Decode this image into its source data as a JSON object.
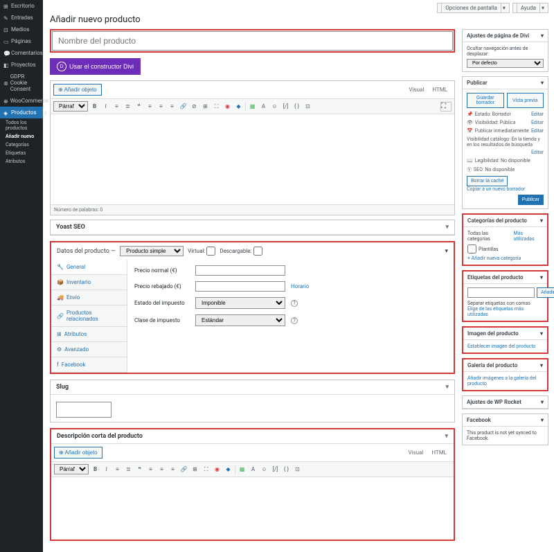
{
  "topbar": {
    "screen_options": "Opciones de pantalla",
    "help": "Ayuda"
  },
  "page_title": "Añadir nuevo producto",
  "title_placeholder": "Nombre del producto",
  "divi_btn": "Usar el constructor Divi",
  "sidebar": {
    "items": [
      {
        "label": "Escritorio"
      },
      {
        "label": "Entradas"
      },
      {
        "label": "Medios"
      },
      {
        "label": "Páginas"
      },
      {
        "label": "Comentarios"
      },
      {
        "label": "Proyectos"
      },
      {
        "label": "GDPR Cookie Consent"
      },
      {
        "label": "WooCommerce"
      },
      {
        "label": "Productos"
      }
    ],
    "subs": [
      {
        "label": "Todos los productos"
      },
      {
        "label": "Añadir nuevo"
      },
      {
        "label": "Categorías"
      },
      {
        "label": "Etiquetas"
      },
      {
        "label": "Atributos"
      }
    ]
  },
  "editor": {
    "add_object": "Añadir objeto",
    "visual": "Visual",
    "html": "HTML",
    "format": "Párrafo",
    "word_count": "Número de palabras: 0"
  },
  "yoast": {
    "title": "Yoast SEO"
  },
  "product_data": {
    "title": "Datos del producto —",
    "type": "Producto simple",
    "virtual": "Virtual:",
    "downloadable": "Descargable:",
    "tabs": [
      "General",
      "Inventario",
      "Envío",
      "Productos relacionados",
      "Atributos",
      "Avanzado",
      "Facebook"
    ],
    "price_normal": "Precio normal (€)",
    "price_sale": "Precio rebajado (€)",
    "schedule": "Horario",
    "tax_status": "Estado del impuesto",
    "tax_status_val": "Imponible",
    "tax_class": "Clase de impuesto",
    "tax_class_val": "Estándar"
  },
  "slug": {
    "title": "Slug"
  },
  "short_desc": {
    "title": "Descripción corta del producto"
  },
  "divi_box": {
    "title": "Ajustes de página de Divi",
    "hide_nav": "Ocultar navegación antes de desplazar:",
    "default": "Por defecto"
  },
  "publish": {
    "title": "Publicar",
    "save_draft": "Guardar borrador",
    "preview": "Vista previa",
    "status": "Estado: Borrador",
    "visibility": "Visibilidad: Pública",
    "publish_on": "Publicar inmediatamente",
    "catalog": "Visibilidad catálogo: En la tienda y en los resultados de búsqueda",
    "readability": "Legibilidad: No disponible",
    "seo": "SEO: No disponible",
    "edit": "Editar",
    "clear_cache": "Borrar la caché",
    "copy_draft": "Copiar a un nuevo borrador",
    "publish_btn": "Publicar"
  },
  "categories": {
    "title": "Categorías del producto",
    "all": "Todas las categorías",
    "most_used": "Más utilizadas",
    "item": "Plantillas",
    "add_new": "+ Añadir nueva categoría"
  },
  "tags": {
    "title": "Etiquetas del producto",
    "add": "Añadir",
    "separate": "Separar etiquetas con comas",
    "choose": "Elige de las etiquetas más utilizadas"
  },
  "image": {
    "title": "Imagen del producto",
    "set": "Establecer imagen del producto"
  },
  "gallery": {
    "title": "Galería del producto",
    "add": "Añadir imágenes a la galería del producto"
  },
  "wprocket": {
    "title": "Ajustes de WP Rocket"
  },
  "facebook": {
    "title": "Facebook",
    "not_synced": "This product is not yet synced to Facebook."
  }
}
